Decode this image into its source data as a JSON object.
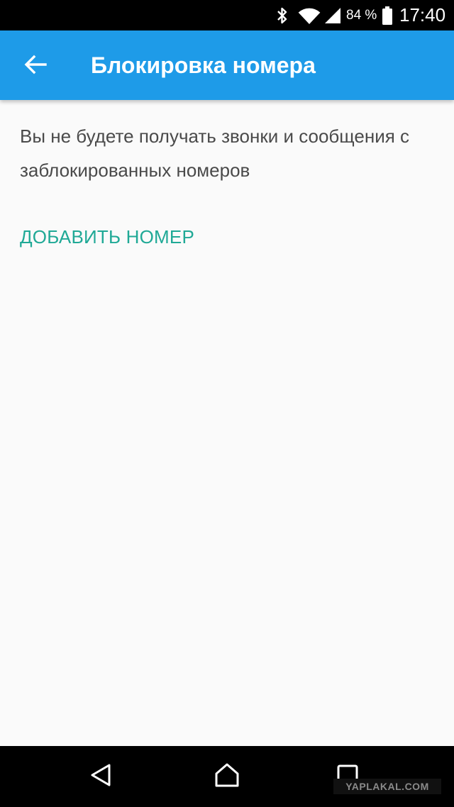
{
  "status_bar": {
    "battery_percent": "84 %",
    "time": "17:40",
    "icons": [
      "bluetooth-icon",
      "wifi-icon",
      "cell-signal-icon",
      "battery-icon"
    ]
  },
  "app_bar": {
    "title": "Блокировка номера",
    "back_icon": "arrow-left-icon",
    "background_color": "#1e9be8"
  },
  "content": {
    "description": "Вы не будете получать звонки и сообщения с заблокированных номеров",
    "add_number_label": "ДОБАВИТЬ НОМЕР",
    "accent_color": "#20a996"
  },
  "nav_bar": {
    "icons": [
      "nav-back-icon",
      "nav-home-icon",
      "nav-recents-icon"
    ]
  },
  "watermark": "YAPLAKAL.COM"
}
